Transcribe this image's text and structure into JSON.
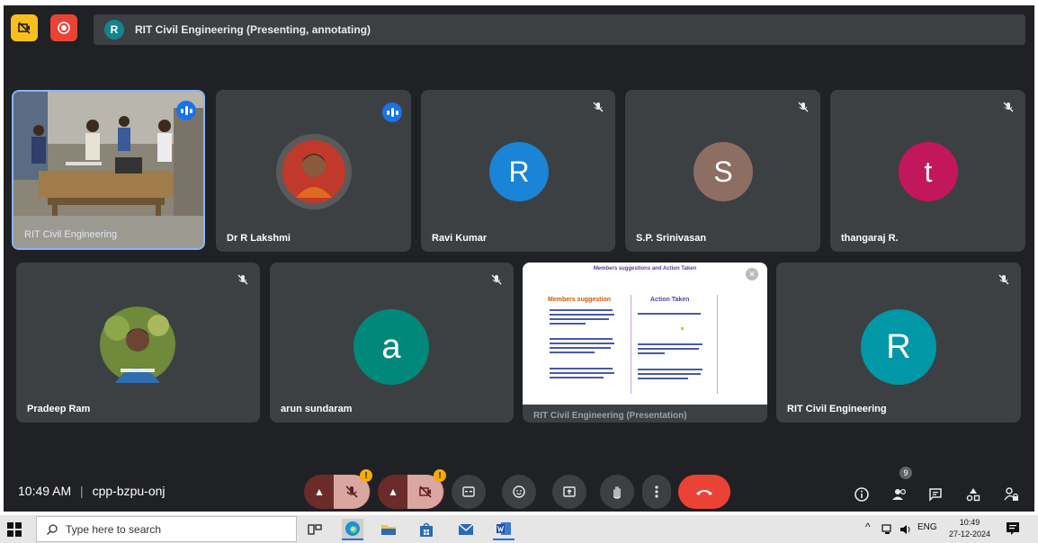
{
  "meeting": {
    "presentation_label": "RIT Civil Engineering (Presenting, annotating)",
    "presenter_initial": "R",
    "time": "10:49 AM",
    "separator": "|",
    "meeting_code": "cpp-bzpu-onj",
    "mic_badge": "!",
    "cam_badge": "!",
    "people_count": "9"
  },
  "participants": [
    {
      "name": "RIT Civil Engineering"
    },
    {
      "name": "Dr R Lakshmi"
    },
    {
      "name": "Ravi Kumar",
      "initial": "R"
    },
    {
      "name": "S.P. Srinivasan",
      "initial": "S"
    },
    {
      "name": "thangaraj R.",
      "initial": "t"
    },
    {
      "name": "Pradeep Ram"
    },
    {
      "name": "arun sundaram",
      "initial": "a"
    },
    {
      "name": "RIT Civil Engineering (Presentation)"
    },
    {
      "name": "RIT Civil Engineering",
      "initial": "R"
    }
  ],
  "slide": {
    "title": "Members suggestions and Action Taken",
    "left_heading": "Members suggestion",
    "right_heading": "Action Taken"
  },
  "taskbar": {
    "search_placeholder": "Type here to search",
    "lang": "ENG",
    "time": "10:49",
    "date": "27-12-2024"
  },
  "colors": {
    "meet_bg": "#202124",
    "tile_bg": "#3c4043",
    "ravi": "#1a84d6",
    "srinivasan": "#8d6e63",
    "thangaraj": "#c2185b",
    "arun": "#00897b",
    "rit": "#0097a7",
    "end_call": "#ea4335"
  }
}
